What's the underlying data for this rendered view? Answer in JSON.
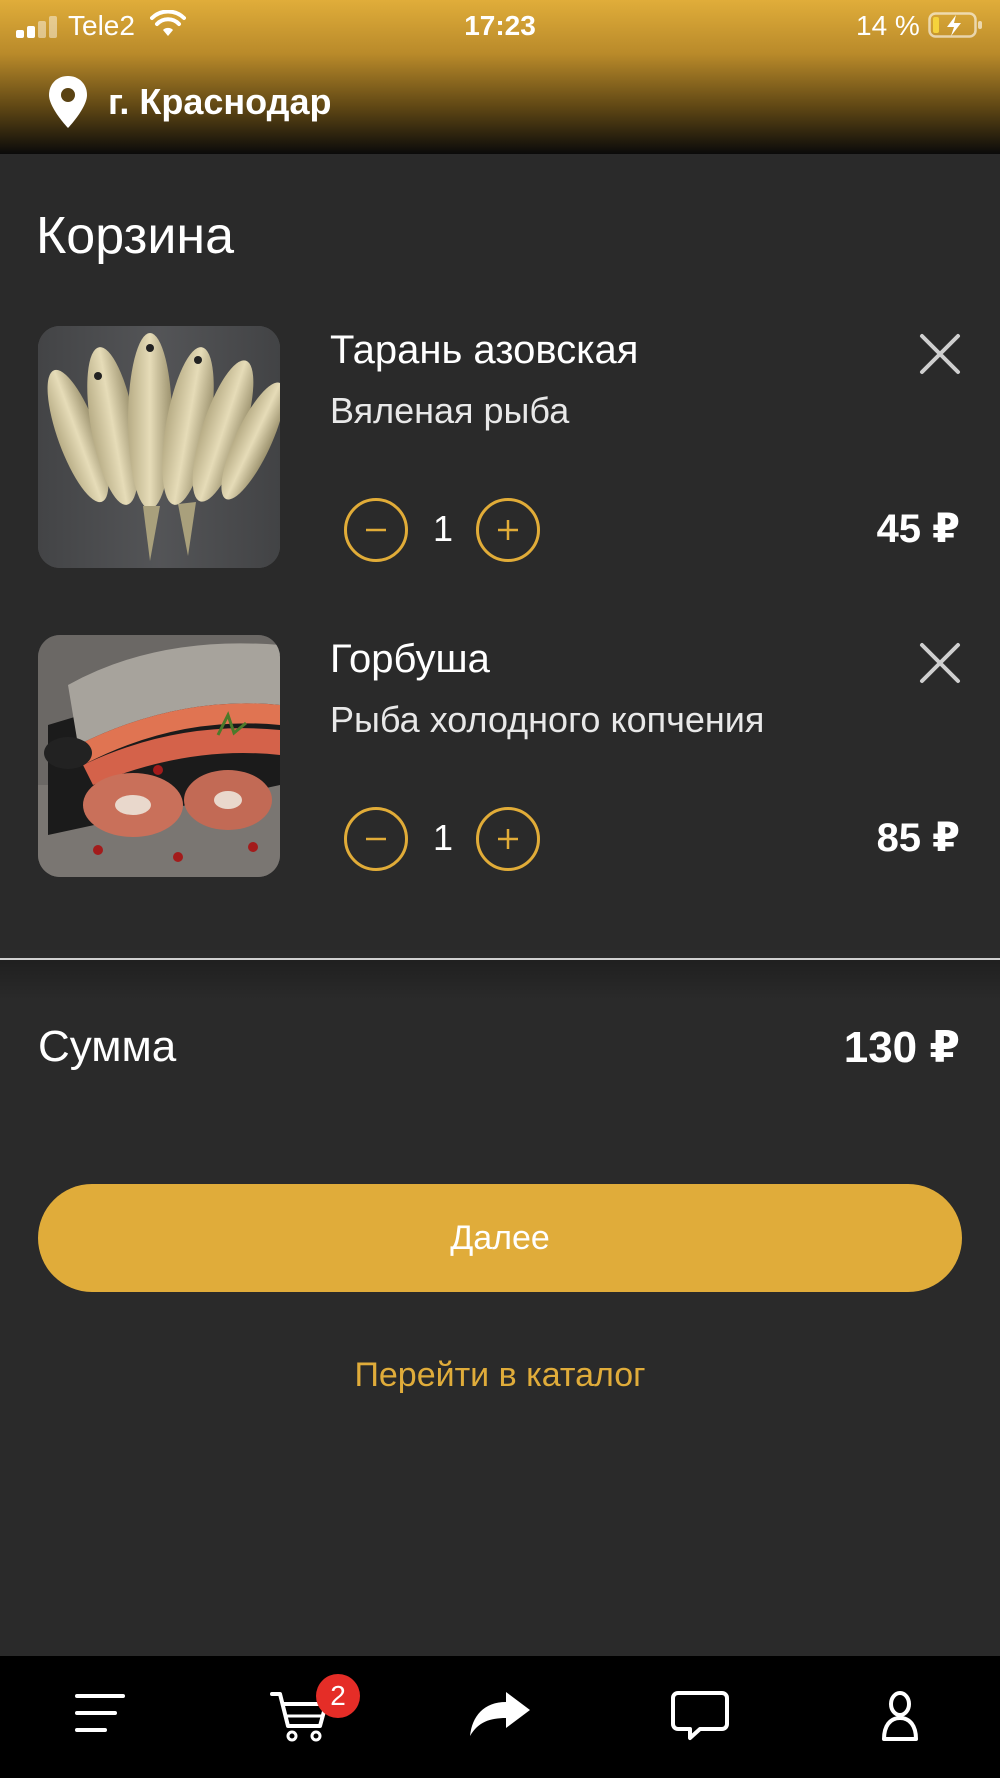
{
  "status_bar": {
    "carrier": "Tele2",
    "time": "17:23",
    "battery_percent": "14 %"
  },
  "header": {
    "location_icon": "map-pin-icon",
    "city": "г. Краснодар"
  },
  "page_title": "Корзина",
  "cart": {
    "items": [
      {
        "name": "Тарань азовская",
        "subtitle": "Вяленая рыба",
        "quantity": "1",
        "price": "45 ₽",
        "image": "dried-fish-photo"
      },
      {
        "name": "Горбуша",
        "subtitle": "Рыба холодного копчения",
        "quantity": "1",
        "price": "85 ₽",
        "image": "smoked-salmon-photo"
      }
    ]
  },
  "summary": {
    "label": "Сумма",
    "total": "130 ₽"
  },
  "actions": {
    "next_label": "Далее",
    "catalog_link": "Перейти в каталог"
  },
  "tab_bar": {
    "items": [
      {
        "icon": "menu-icon"
      },
      {
        "icon": "cart-icon",
        "badge": "2"
      },
      {
        "icon": "share-icon"
      },
      {
        "icon": "chat-icon"
      },
      {
        "icon": "profile-icon"
      }
    ]
  },
  "colors": {
    "accent": "#e0ac3a",
    "background": "#2a2a2a",
    "badge": "#e52d27"
  }
}
